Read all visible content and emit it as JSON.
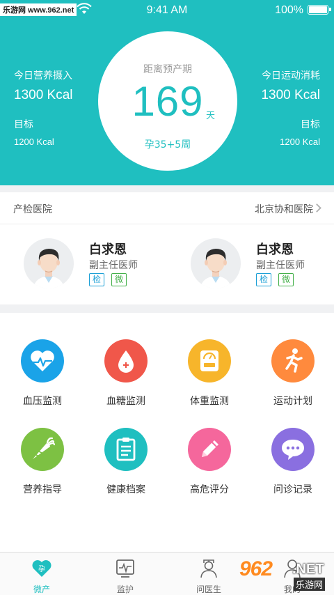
{
  "status_bar": {
    "watermark": "乐游网 www.962.net",
    "time": "9:41 AM",
    "battery": "100%"
  },
  "header": {
    "left": {
      "label": "今日营养摄入",
      "value": "1300 Kcal",
      "goal_label": "目标",
      "goal_value": "1200 Kcal"
    },
    "right": {
      "label": "今日运动消耗",
      "value": "1300 Kcal",
      "goal_label": "目标",
      "goal_value": "1200 Kcal"
    },
    "countdown": {
      "title": "距离预产期",
      "days": "169",
      "unit": "天",
      "week": "孕35+5周"
    }
  },
  "hospital": {
    "label": "产检医院",
    "name": "北京协和医院",
    "doctors": [
      {
        "name": "白求恩",
        "title": "副主任医师",
        "tag_check": "检",
        "tag_wechat": "微"
      },
      {
        "name": "白求恩",
        "title": "副主任医师",
        "tag_check": "检",
        "tag_wechat": "微"
      }
    ]
  },
  "features": [
    {
      "label": "血压监测",
      "icon": "heart-pulse-icon",
      "color": "#1aa3e8"
    },
    {
      "label": "血糖监测",
      "icon": "blood-drop-icon",
      "color": "#f0574a"
    },
    {
      "label": "体重监测",
      "icon": "scale-icon",
      "color": "#f7b52b"
    },
    {
      "label": "运动计划",
      "icon": "running-icon",
      "color": "#ff8a3d"
    },
    {
      "label": "营养指导",
      "icon": "carrot-icon",
      "color": "#7dc143"
    },
    {
      "label": "健康档案",
      "icon": "clipboard-icon",
      "color": "#1fbfc0"
    },
    {
      "label": "高危评分",
      "icon": "pencil-icon",
      "color": "#f5679c"
    },
    {
      "label": "问诊记录",
      "icon": "chat-bubble-icon",
      "color": "#8a6fe0"
    }
  ],
  "tabbar": {
    "tabs": [
      {
        "label": "微产",
        "icon": "pregnancy-heart-icon",
        "active": true
      },
      {
        "label": "监护",
        "icon": "monitor-icon",
        "active": false
      },
      {
        "label": "问医生",
        "icon": "doctor-icon",
        "active": false
      },
      {
        "label": "我的",
        "icon": "person-icon",
        "active": false
      }
    ]
  },
  "watermark_bottom": {
    "big": "962",
    "net": ".NET",
    "cn": "乐游网"
  },
  "colors": {
    "accent": "#1fbfc0",
    "gap": "#f0f1f3"
  }
}
